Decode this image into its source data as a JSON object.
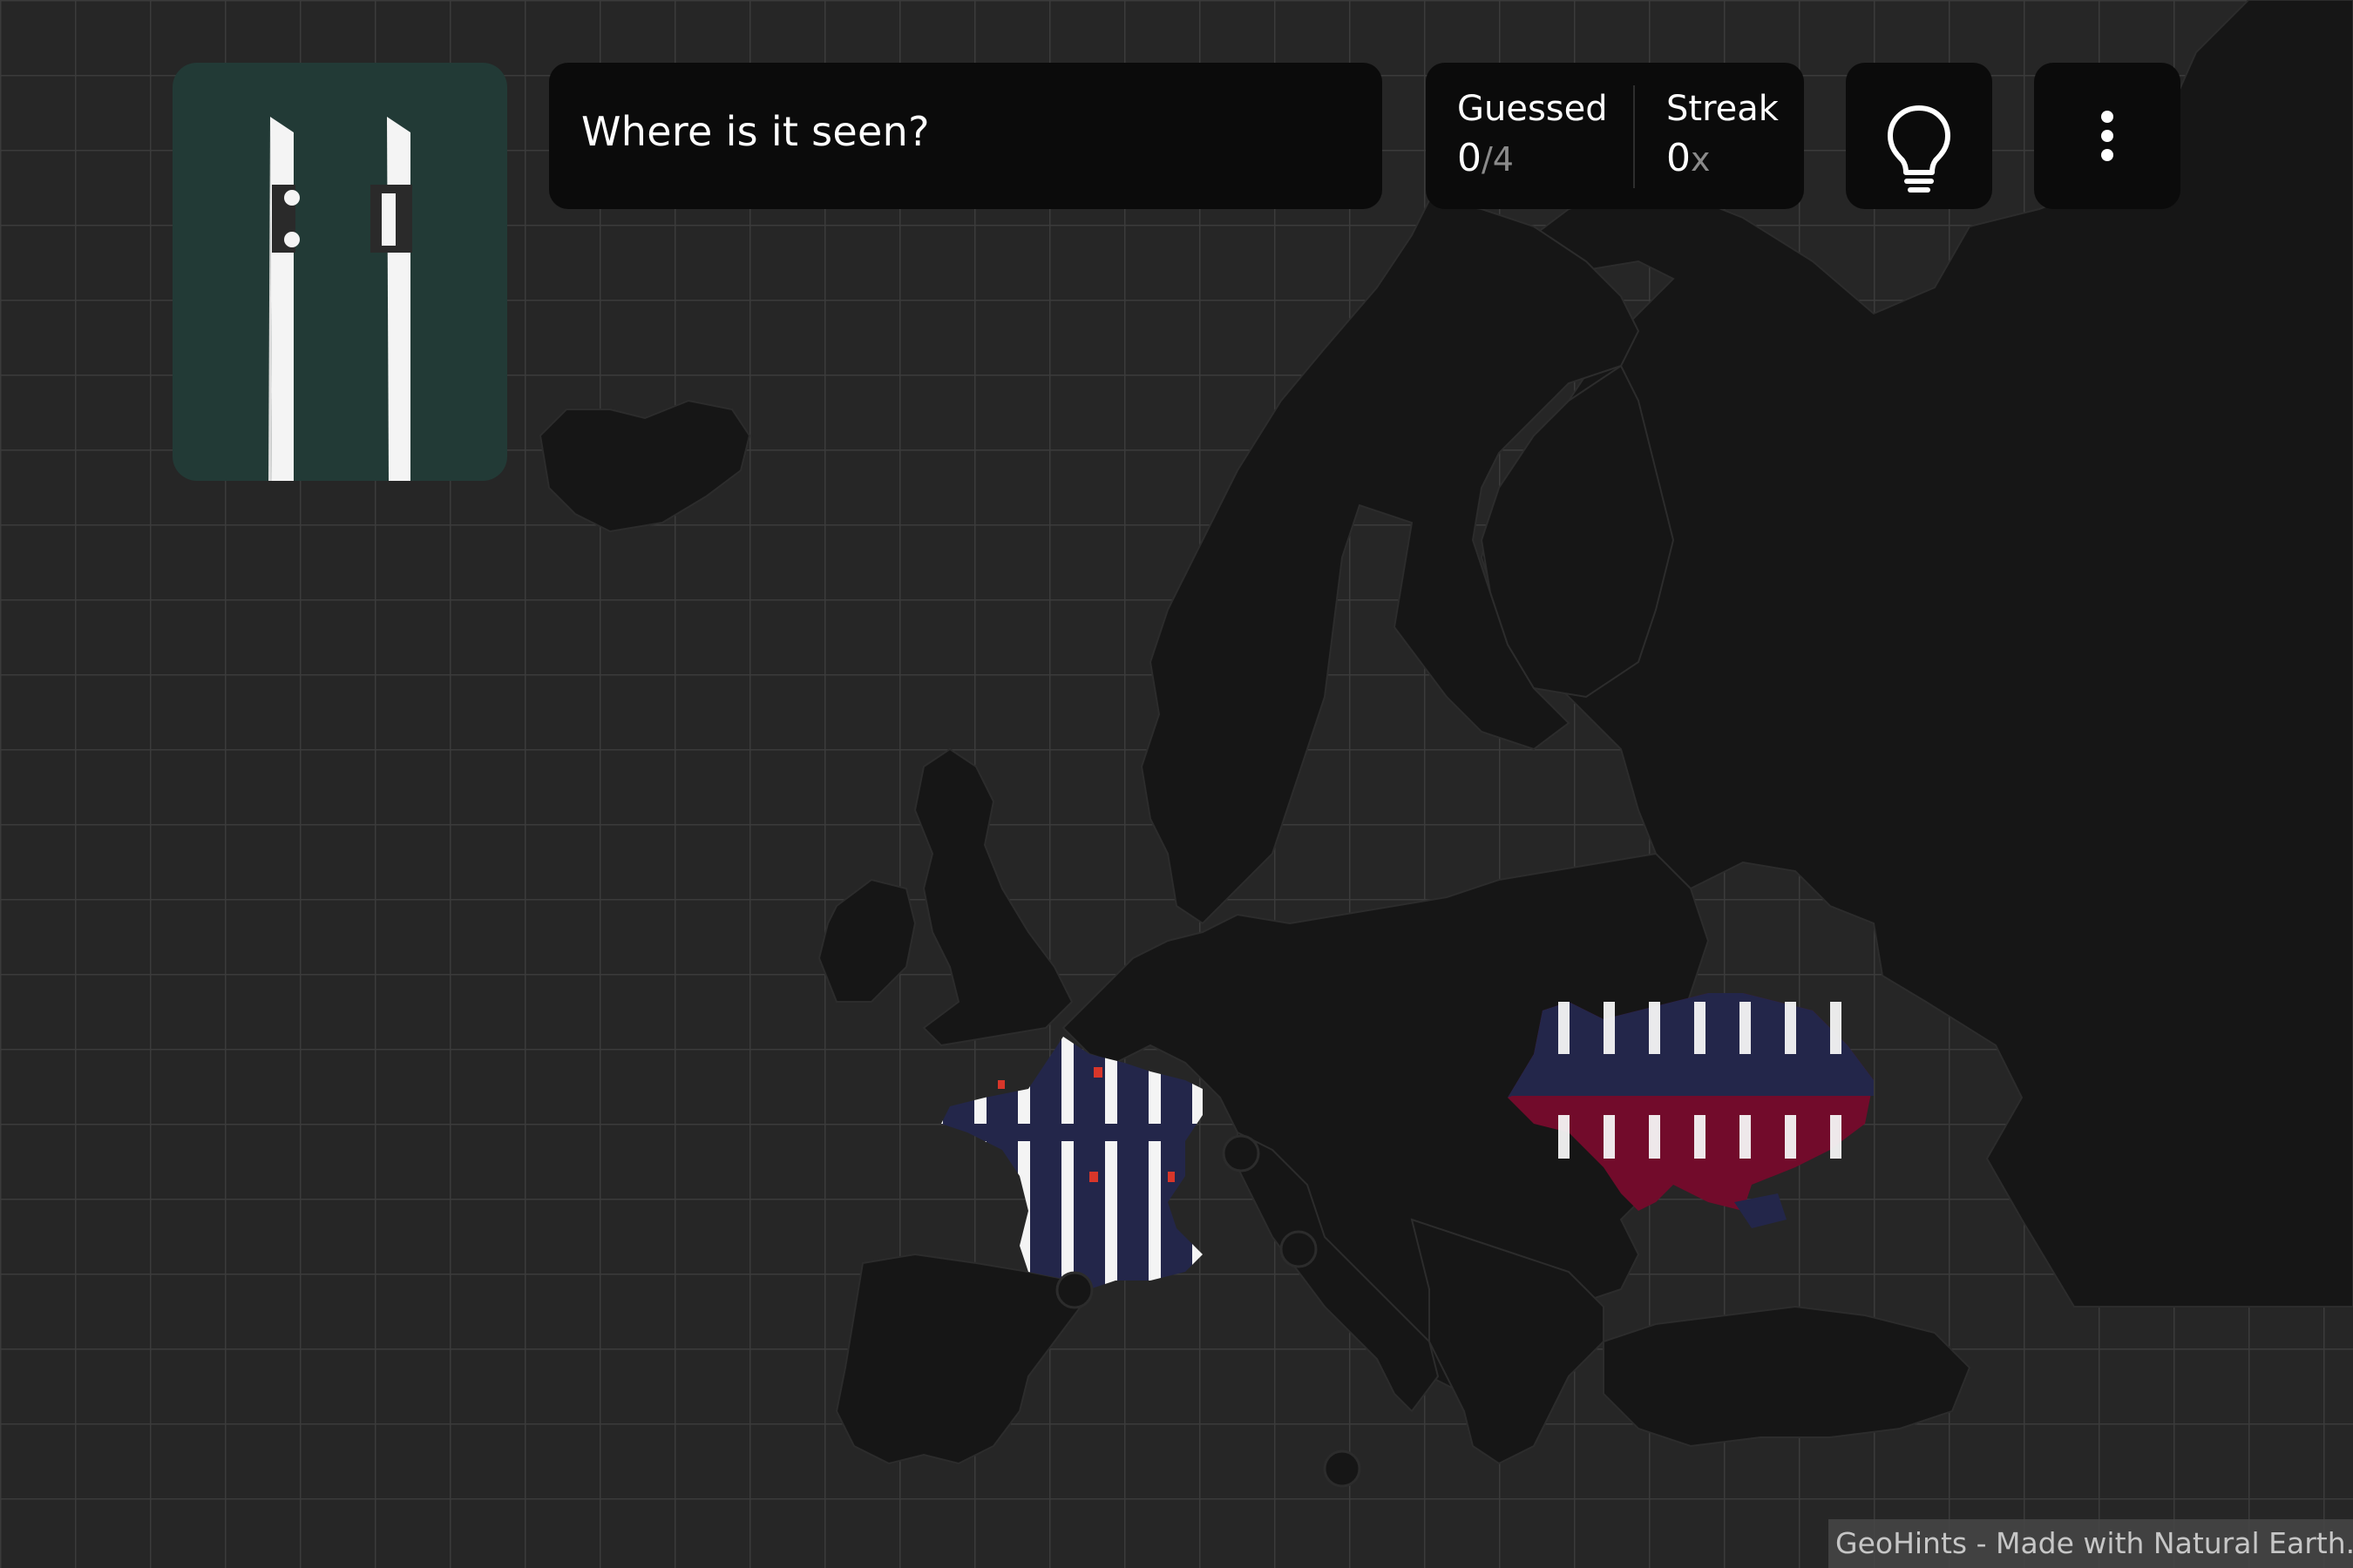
{
  "app": {
    "name": "GeoHints"
  },
  "question": {
    "text": "Where is it seen?"
  },
  "stats": {
    "guessed": {
      "label": "Guessed",
      "value": "0",
      "total": "/4"
    },
    "streak": {
      "label": "Streak",
      "value": "0",
      "suffix": "x"
    }
  },
  "toolbar": {
    "hint_icon": "lightbulb-icon",
    "menu_icon": "more-vertical-icon"
  },
  "hint_image": {
    "icon": "bollard-posts-icon",
    "colors": {
      "background": "#223a36",
      "post": "#f4f4f4",
      "band": "#2a2a2a"
    }
  },
  "map": {
    "region": "Europe",
    "highlighted_countries": [
      "France",
      "Ukraine"
    ],
    "colors": {
      "ocean": "#262626",
      "land": "#161616",
      "grid": "#3a3a3a",
      "highlight_navy": "#23264a",
      "highlight_red": "#720b2b"
    }
  },
  "attribution": {
    "text": "GeoHints - Made with Natural Earth."
  }
}
